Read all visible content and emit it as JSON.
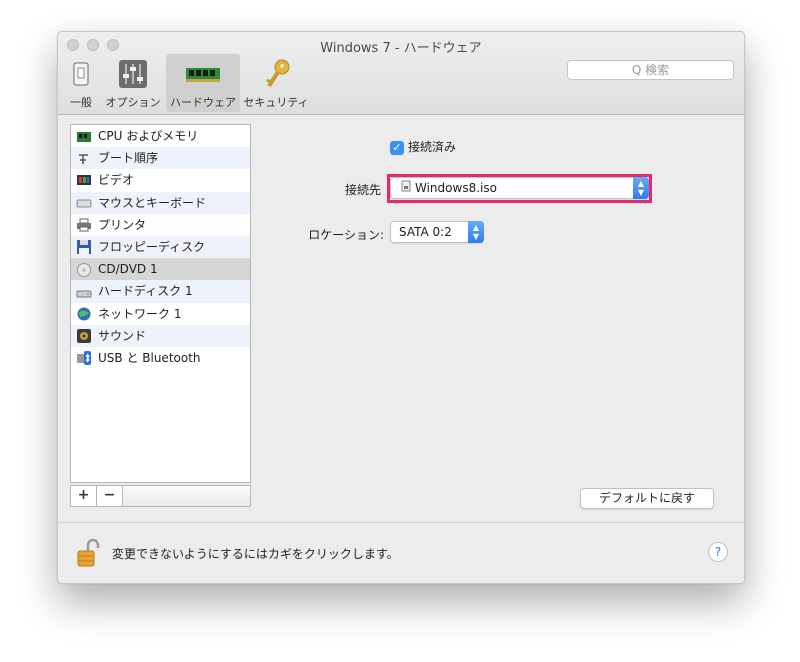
{
  "window": {
    "title": "Windows 7 - ハードウェア"
  },
  "toolbar": {
    "items": [
      {
        "label": "一般",
        "icon": "general-switch-icon"
      },
      {
        "label": "オプション",
        "icon": "options-sliders-icon"
      },
      {
        "label": "ハードウェア",
        "icon": "hardware-ram-icon",
        "selected": true
      },
      {
        "label": "セキュリティ",
        "icon": "security-key-icon"
      }
    ],
    "search_placeholder": "Q 検索"
  },
  "sidebar": {
    "items": [
      {
        "label": "CPU およびメモリ",
        "icon": "cpu-memory-icon"
      },
      {
        "label": "ブート順序",
        "icon": "boot-order-icon"
      },
      {
        "label": "ビデオ",
        "icon": "video-icon"
      },
      {
        "label": "マウスとキーボード",
        "icon": "keyboard-icon"
      },
      {
        "label": "プリンタ",
        "icon": "printer-icon"
      },
      {
        "label": "フロッピーディスク",
        "icon": "floppy-icon"
      },
      {
        "label": "CD/DVD 1",
        "icon": "cd-dvd-icon",
        "selected": true
      },
      {
        "label": "ハードディスク 1",
        "icon": "hard-disk-icon"
      },
      {
        "label": "ネットワーク 1",
        "icon": "network-globe-icon"
      },
      {
        "label": "サウンド",
        "icon": "speaker-icon"
      },
      {
        "label": "USB と Bluetooth",
        "icon": "usb-bluetooth-icon"
      }
    ],
    "add_label": "+",
    "remove_label": "−"
  },
  "main": {
    "connected_label": "接続済み",
    "connected_checked": true,
    "source_label": "接続先",
    "source_value": "Windows8.iso",
    "location_label": "ロケーション:",
    "location_value": "SATA 0:2",
    "default_button": "デフォルトに戻す"
  },
  "footer": {
    "lock_text": "変更できないようにするにはカギをクリックします。",
    "help_label": "?"
  },
  "colors": {
    "highlight": "#e6296e",
    "accent": "#3d8ef5",
    "selected_row": "#d6d6d6"
  }
}
